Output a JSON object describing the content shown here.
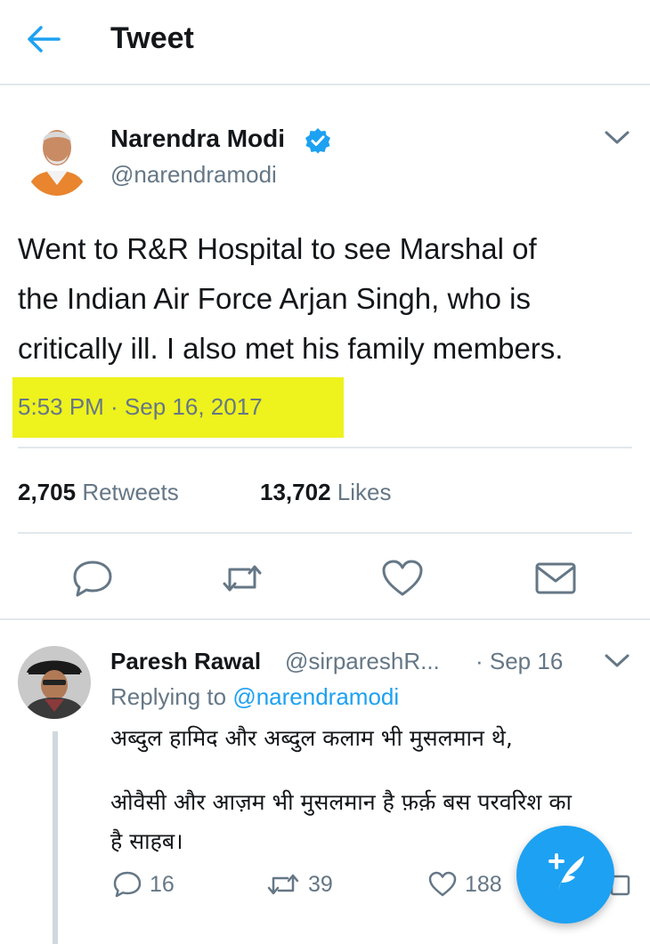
{
  "header": {
    "title": "Tweet",
    "back_icon": "arrow-left-icon"
  },
  "colors": {
    "accent": "#1da1f2",
    "text": "#14171a",
    "secondary": "#657786",
    "highlight": "#eef21d",
    "divider": "#e1e8ed"
  },
  "tweet": {
    "author_name": "Narendra Modi",
    "author_handle": "@narendramodi",
    "verified": true,
    "text_lines": [
      "Went to R&R Hospital to see Marshal of",
      "the Indian Air Force Arjan Singh, who is",
      "critically ill. I also met his family members."
    ],
    "timestamp": "5:53 PM · Sep 16, 2017",
    "retweets_count": "2,705",
    "retweets_label": "Retweets",
    "likes_count": "13,702",
    "likes_label": "Likes",
    "actions": [
      "reply-icon",
      "retweet-icon",
      "like-icon",
      "share-icon"
    ]
  },
  "reply": {
    "author_name": "Paresh Rawal",
    "author_handle": "@sirpareshR...",
    "date": "· Sep 16",
    "replying_prefix": "Replying to",
    "replying_handle": "@narendramodi",
    "text_lines": [
      "अब्दुल हामिद और अब्दुल कलाम भी मुसलमान थे,",
      "ओवैसी और आज़म भी मुसलमान है फ़र्क़ बस परवरिश का",
      "है साहब।"
    ],
    "reply_count": "16",
    "retweet_count": "39",
    "like_count": "188"
  },
  "fab": {
    "icon": "compose-tweet-icon"
  }
}
